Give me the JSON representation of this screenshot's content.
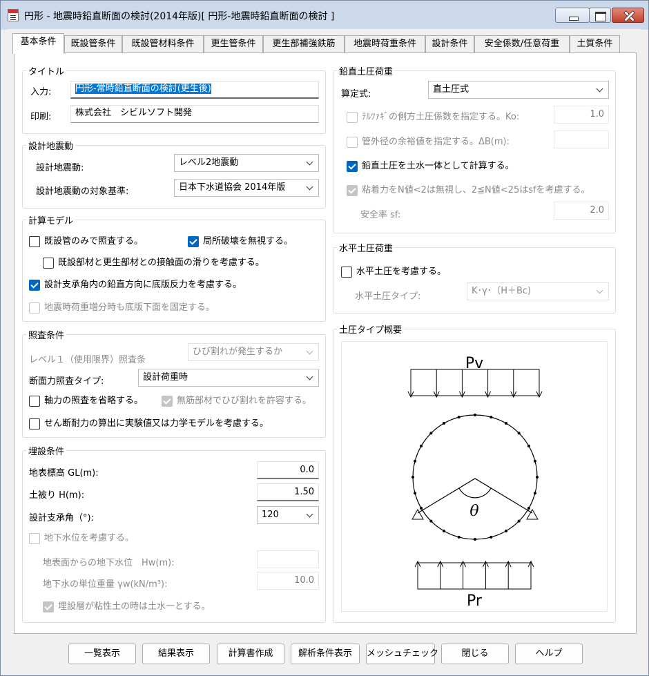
{
  "window": {
    "title": "円形 - 地震時鉛直断面の検討(2014年版)[ 円形-地震時鉛直断面の検討 ]"
  },
  "tabs": [
    "基本条件",
    "既設管条件",
    "既設管材料条件",
    "更生管条件",
    "更生部補強鉄筋",
    "地震時荷重条件",
    "設計条件",
    "安全係数/任意荷重",
    "土質条件"
  ],
  "title_group": {
    "label": "タイトル",
    "input_label": "入力:",
    "input_value": "円形-常時鉛直断面の検討(更生後)",
    "print_label": "印刷:",
    "print_value": "株式会社　シビルソフト開発"
  },
  "seismic_group": {
    "label": "設計地震動",
    "motion_label": "設計地震動:",
    "motion_value": "レベル2地震動",
    "standard_label": "設計地震動の対象基準:",
    "standard_value": "日本下水道協会 2014年版"
  },
  "model_group": {
    "label": "計算モデル",
    "existing_only": "既設管のみで照査する。",
    "ignore_local": "局所破壊を無視する。",
    "slip": "既設部材と更生部材との接触面の滑りを考慮する。",
    "reaction": "設計支承角内の鉛直方向に底版反力を考慮する。",
    "fix_bottom": "地震時荷重増分時も底版下面を固定する。"
  },
  "check_group": {
    "label": "照査条件",
    "level1_label": "レベル１（使用限界）照査条",
    "level1_value": "ひび割れが発生するか",
    "type_label": "断面力照査タイプ:",
    "type_value": "設計荷重時",
    "omit_axial": "軸力の照査を省略する。",
    "allow_crack": "無筋部材でひび割れを許容する。",
    "shear": "せん断耐力の算出に実験値又は力学モデルを考慮する。"
  },
  "burial_group": {
    "label": "埋設条件",
    "gl_label": "地表標高 GL(m):",
    "gl_value": "0.0",
    "cover_label": "土被り H(m):",
    "cover_value": "1.50",
    "angle_label": "設計支承角（°):",
    "angle_value": "120",
    "gw_check": "地下水位を考慮する。",
    "hw_label": "地表面からの地下水位　Hw(m):",
    "hw_value": "",
    "gw_weight_label": "地下水の単位重量 γw(kN/m³):",
    "gw_weight_value": "10.0",
    "clay_check": "埋設層が粘性土の時は土水一とする。"
  },
  "vertical_group": {
    "label": "鉛直土圧荷重",
    "formula_label": "算定式:",
    "formula_value": "直土圧式",
    "terzaghi": "ﾃﾙﾂｧｷﾞの側方土圧係数を指定する。Ko:",
    "terzaghi_value": "1.0",
    "margin": "管外径の余裕値を指定する。ΔB(m):",
    "margin_value": "",
    "combined": "鉛直土圧を土水一体として計算する。",
    "cohesion": "粘着力をN値<2は無視し、2≦N値<25はsfを考慮する。",
    "sf_label": "安全率 sf:",
    "sf_value": "2.0"
  },
  "horizontal_group": {
    "label": "水平土圧荷重",
    "consider": "水平土圧を考慮する。",
    "type_label": "水平土圧タイプ:",
    "type_value": "K･γ･（H＋Bc)"
  },
  "overview_group": {
    "label": "土圧タイプ概要",
    "pv": "Pv",
    "pr": "Pr",
    "theta": "θ"
  },
  "buttons": [
    "一覧表示",
    "結果表示",
    "計算書作成",
    "解析条件表示",
    "メッシュチェック",
    "閉じる",
    "ヘルプ"
  ],
  "colors": {
    "accent": "#0067c0",
    "selection": "#0078d7",
    "titlebar": "#ccd9ea"
  }
}
